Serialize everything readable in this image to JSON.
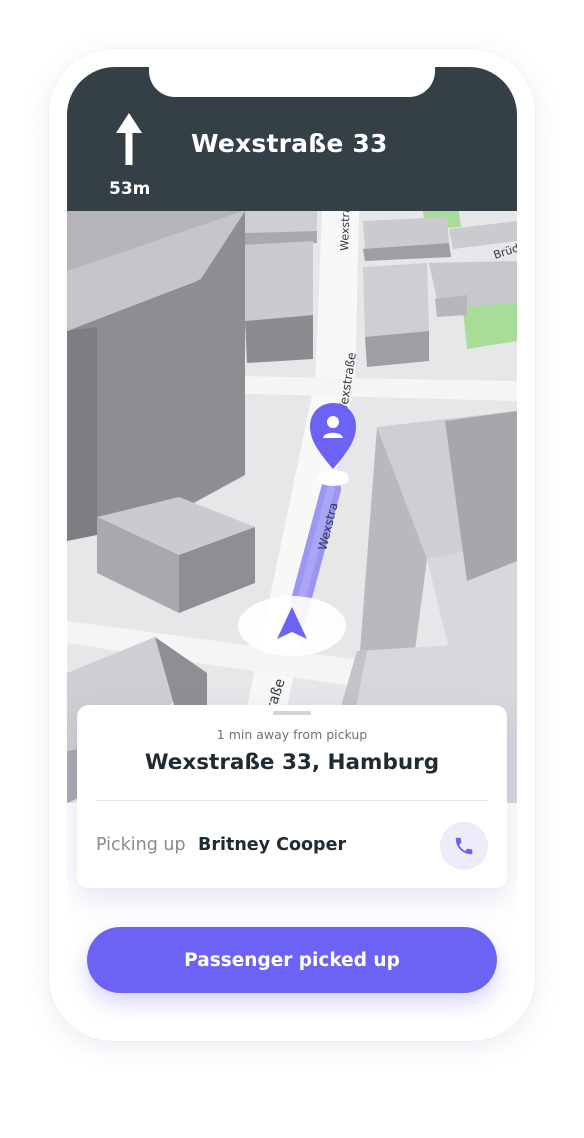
{
  "navigation": {
    "street": "Wexstraße 33",
    "distance": "53m",
    "maneuver_icon": "arrow-up-icon"
  },
  "map": {
    "street_labels": [
      "Wexstra",
      "Wexstraße",
      "Wexstraße",
      "Wexstraße",
      "Brüd"
    ],
    "route_color": "#6c63f5"
  },
  "pickup_card": {
    "eta": "1 min away from pickup",
    "address": "Wexstraße 33, Hamburg",
    "picking_up_label": "Picking up",
    "passenger_name": "Britney Cooper",
    "call_icon": "phone-icon"
  },
  "actions": {
    "primary_label": "Passenger picked up"
  },
  "colors": {
    "header": "#343f46",
    "accent": "#6c63f5",
    "accent_light": "#eeecfb"
  }
}
